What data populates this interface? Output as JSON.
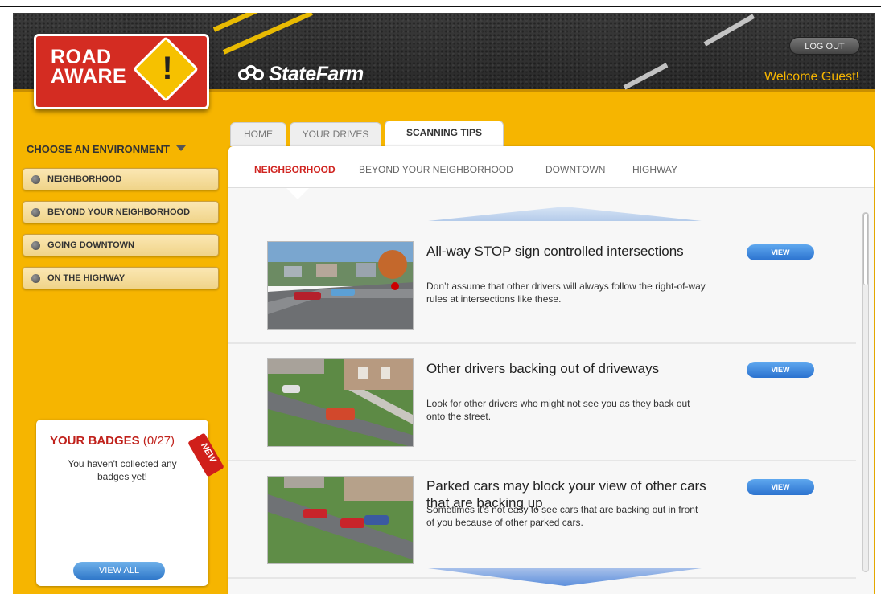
{
  "header": {
    "logo_line1": "ROAD",
    "logo_line2": "AWARE",
    "brand": "StateFarm",
    "logout_label": "LOG OUT",
    "welcome": "Welcome Guest!"
  },
  "sidebar": {
    "title": "CHOOSE AN ENVIRONMENT",
    "items": [
      {
        "label": "NEIGHBORHOOD"
      },
      {
        "label": "BEYOND YOUR NEIGHBORHOOD"
      },
      {
        "label": "GOING DOWNTOWN"
      },
      {
        "label": "ON THE HIGHWAY"
      }
    ]
  },
  "badges": {
    "title": "YOUR BADGES",
    "count": "(0/27)",
    "text": "You haven't collected any badges yet!",
    "view_all": "VIEW ALL",
    "new_tag": "NEW"
  },
  "tabs": [
    {
      "label": "HOME",
      "active": false
    },
    {
      "label": "YOUR DRIVES",
      "active": false
    },
    {
      "label": "SCANNING TIPS",
      "active": true
    }
  ],
  "subnav": [
    {
      "label": "NEIGHBORHOOD",
      "active": true
    },
    {
      "label": "BEYOND YOUR NEIGHBORHOOD",
      "active": false
    },
    {
      "label": "DOWNTOWN",
      "active": false
    },
    {
      "label": "HIGHWAY",
      "active": false
    }
  ],
  "tips": [
    {
      "title": "All-way STOP sign controlled intersections",
      "description": "Don’t assume that other drivers will always follow the right-of-way rules at intersections like these.",
      "button": "VIEW"
    },
    {
      "title": "Other drivers backing out of driveways",
      "description": "Look for other drivers who might not see you as they back out onto the street.",
      "button": "VIEW"
    },
    {
      "title": "Parked cars may block your view of other cars that are backing up",
      "description": "Sometimes it’s not easy to see cars that are backing out in front of you because of other parked cars.",
      "button": "VIEW"
    }
  ],
  "colors": {
    "background": "#f6b500",
    "accent_red": "#d02420",
    "button_blue": "#2b72cf"
  }
}
